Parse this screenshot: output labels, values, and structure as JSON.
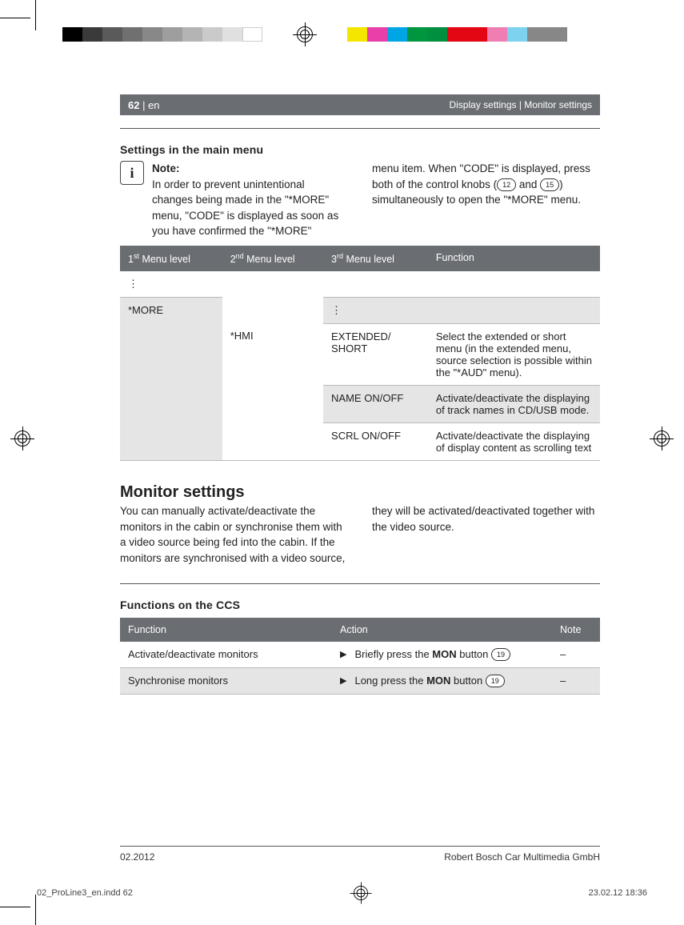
{
  "header": {
    "page_num": "62",
    "lang_sep": " | en",
    "breadcrumb": "Display settings | Monitor settings"
  },
  "sections": {
    "settings_title": "Settings in the main menu",
    "monitor_title": "Monitor settings",
    "ccs_title": "Functions on the CCS"
  },
  "note": {
    "label": "Note:",
    "col1": "In order to prevent unintentional changes being made in the \"*MORE\" menu, \"CODE\" is displayed as soon as you have confirmed the \"*MORE\"",
    "col2_a": "menu item. When \"CODE\" is displayed, press both of the control knobs (",
    "knob1": "12",
    "col2_b": " and ",
    "knob2": "15",
    "col2_c": ") simultaneously to open the \"*MORE\" menu."
  },
  "table1": {
    "headers": {
      "c1a": "1",
      "c1b": "st",
      "c1c": " Menu level",
      "c2a": "2",
      "c2b": "nd",
      "c2c": " Menu level",
      "c3a": "3",
      "c3b": "rd",
      "c3c": " Menu level",
      "c4": "Function"
    },
    "r1": {
      "c1": "⋮",
      "c2": "",
      "c3": "",
      "c4": ""
    },
    "r2": {
      "c1": "*MORE",
      "c2": "⋮",
      "c3": "",
      "c4": ""
    },
    "r3": {
      "c2": "*HMI",
      "c3": "EXTENDED/\nSHORT",
      "c4": "Select the extended or short menu (in the extended menu, source selection is possible within the \"*AUD\" menu)."
    },
    "r4": {
      "c3": "NAME ON/OFF",
      "c4": "Activate/deactivate the displaying of track names in CD/USB mode."
    },
    "r5": {
      "c3": "SCRL ON/OFF",
      "c4": "Activate/deactivate the displaying of display content as scrolling text"
    }
  },
  "monitor_body": {
    "col1": "You can manually activate/deactivate the monitors in the cabin or synchronise them with a video source being fed into the cabin. If the monitors are synchronised with a video source,",
    "col2": "they will be activated/deactivated together with the video source."
  },
  "table2": {
    "headers": {
      "c1": "Function",
      "c2": "Action",
      "c3": "Note"
    },
    "r1": {
      "c1": "Activate/deactivate monitors",
      "c2a": "Briefly press the ",
      "c2b": "MON",
      "c2c": " button ",
      "btn": "19",
      "c3": "–"
    },
    "r2": {
      "c1": "Synchronise monitors",
      "c2a": "Long press the ",
      "c2b": "MON",
      "c2c": " button ",
      "btn": "19",
      "c3": "–"
    }
  },
  "footer": {
    "date": "02.2012",
    "company": "Robert Bosch Car Multimedia GmbH"
  },
  "imprint": {
    "file": "02_ProLine3_en.indd   62",
    "stamp": "23.02.12   18:36"
  },
  "colorbar": [
    "#000000",
    "#3a3a3a",
    "#5a5a5a",
    "#707070",
    "#888888",
    "#9e9e9e",
    "#b4b4b4",
    "#cacaca",
    "#e0e0e0",
    "#ffffff",
    "",
    "#f5e600",
    "#e83fa8",
    "#00a5e5",
    "#009640",
    "#008f3f",
    "#e30613",
    "#e30613",
    "#ef7eb3",
    "#7dd2f0",
    "#878787",
    "#878787"
  ]
}
